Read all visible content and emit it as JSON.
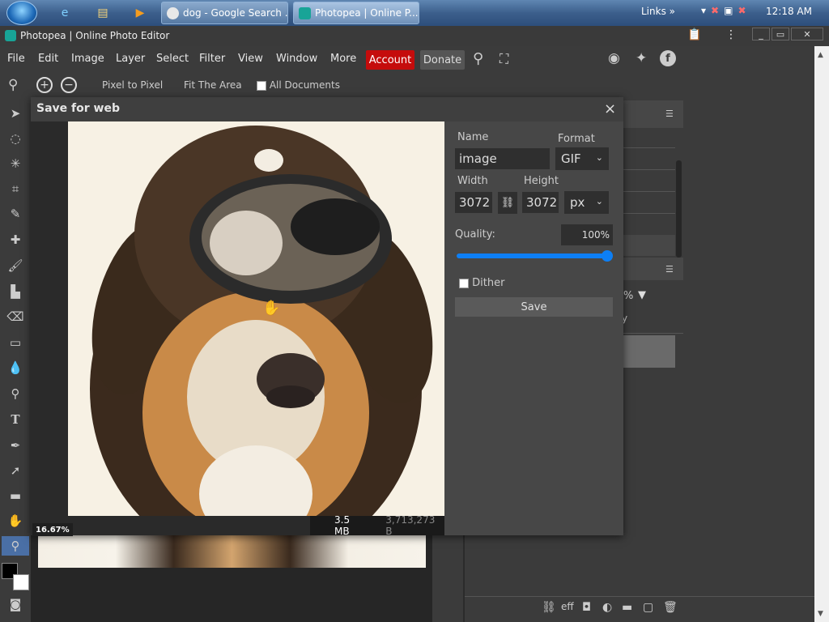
{
  "taskbar": {
    "tasks": [
      {
        "label": "dog - Google Search ..."
      },
      {
        "label": "Photopea | Online P..."
      }
    ],
    "links_label": "Links",
    "clock": "12:18 AM"
  },
  "window": {
    "title": "Photopea | Online Photo Editor"
  },
  "menu": {
    "items": [
      "File",
      "Edit",
      "Image",
      "Layer",
      "Select",
      "Filter",
      "View",
      "Window",
      "More"
    ],
    "account_label": "Account",
    "donate_label": "Donate"
  },
  "options": {
    "pixel_to_pixel": "Pixel to Pixel",
    "fit_the_area": "Fit The Area",
    "all_documents": "All Documents"
  },
  "dialog": {
    "title": "Save for web",
    "name_label": "Name",
    "name_value": "image",
    "format_label": "Format",
    "format_value": "GIF",
    "width_label": "Width",
    "width_value": "3072",
    "height_label": "Height",
    "height_value": "3072",
    "unit_value": "px",
    "quality_label": "Quality:",
    "quality_value": "100%",
    "dither_label": "Dither",
    "save_label": "Save",
    "zoom": "16.67%",
    "file_size": "3.5 MB",
    "file_bytes": "3,713,273 B"
  },
  "right_panel": {
    "percent_fragment": "%",
    "y_fragment": "y"
  },
  "colors": {
    "account_bg": "#c50c0c",
    "accent_blue": "#0d7ff5",
    "photopea_teal": "#18a497"
  }
}
